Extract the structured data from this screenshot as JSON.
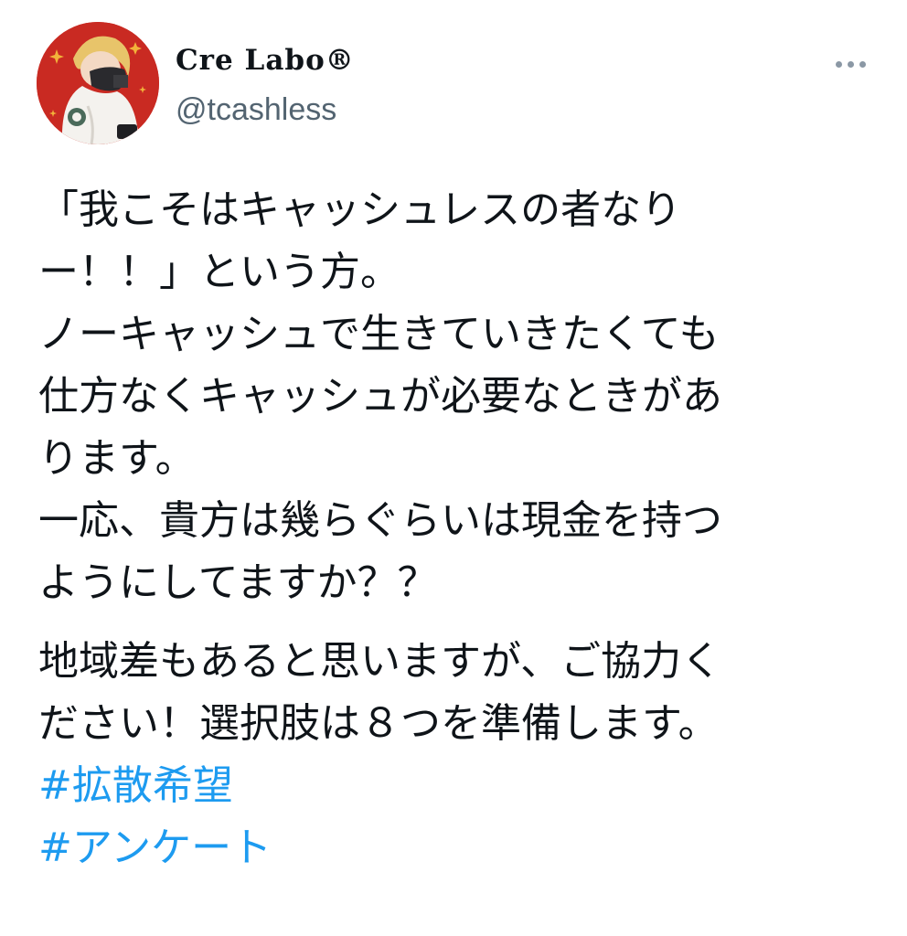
{
  "tweet": {
    "author": {
      "display_name": "Cre Labo®",
      "handle": "@tcashless"
    },
    "more_icon": "more-horizontal-icon",
    "paragraph1": [
      "「我こそはキャッシュレスの者なり",
      "ー！！」という方。",
      "ノーキャッシュで生きていきたくても",
      "仕方なくキャッシュが必要なときがあ",
      "ります。",
      "一応、貴方は幾らぐらいは現金を持つ",
      "ようにしてますか？？"
    ],
    "paragraph2": [
      "地域差もあると思いますが、ご協力く",
      "ださい！選択肢は８つを準備します。"
    ],
    "hashtags": [
      "#拡散希望",
      "#アンケート"
    ],
    "colors": {
      "link": "#1d9bf0",
      "secondary_text": "#536471",
      "primary_text": "#0f1419",
      "avatar_background": "#c92a22"
    }
  }
}
